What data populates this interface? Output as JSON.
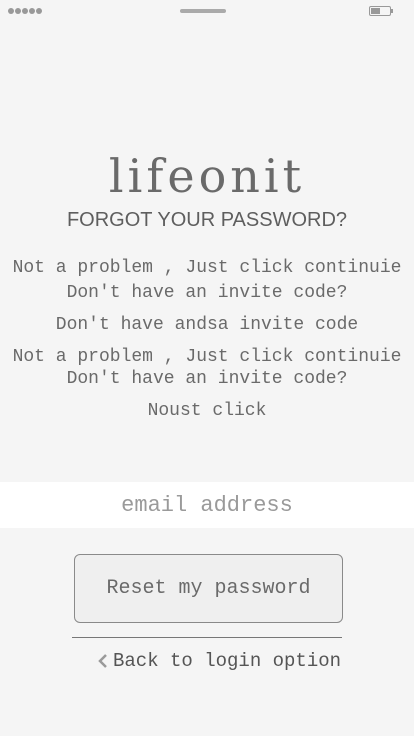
{
  "app": {
    "logo": "lifeonit",
    "title": "FORGOT YOUR PASSWORD?"
  },
  "messages": [
    "Not a problem , Just click continuie",
    "Don't have an invite code?",
    "Don't have andsa invite code",
    "Not a problem , Just click continuie",
    "Don't have an invite code?",
    "Noust click"
  ],
  "email": {
    "placeholder": "email address",
    "value": ""
  },
  "actions": {
    "reset_label": "Reset my password",
    "back_label": "Back to login option"
  },
  "icons": {
    "back": "chevron-left-icon"
  }
}
